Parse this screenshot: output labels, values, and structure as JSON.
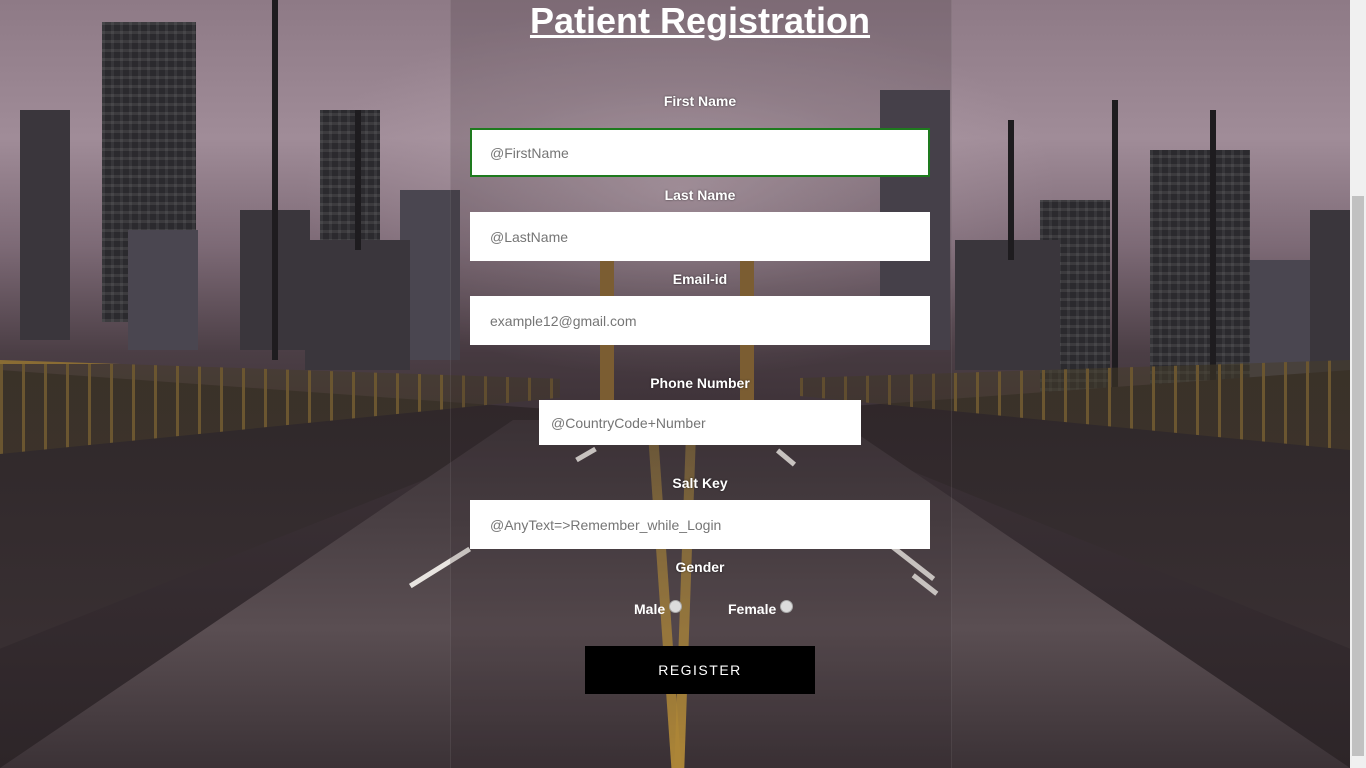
{
  "form": {
    "title": "Patient Registration",
    "first_name_label": "First Name",
    "first_name_placeholder": "@FirstName",
    "last_name_label": "Last Name",
    "last_name_placeholder": "@LastName",
    "email_label": "Email-id",
    "email_placeholder": "example12@gmail.com",
    "phone_label": "Phone Number",
    "phone_placeholder": "@CountryCode+Number",
    "salt_label": "Salt Key",
    "salt_placeholder": "@AnyText=>Remember_while_Login",
    "gender_label": "Gender",
    "gender_options": [
      "Male",
      "Female"
    ],
    "register_label": "REGISTER"
  },
  "colors": {
    "focus_border": "#1e7a1e",
    "button_bg": "#000000",
    "button_text": "#ffffff"
  }
}
